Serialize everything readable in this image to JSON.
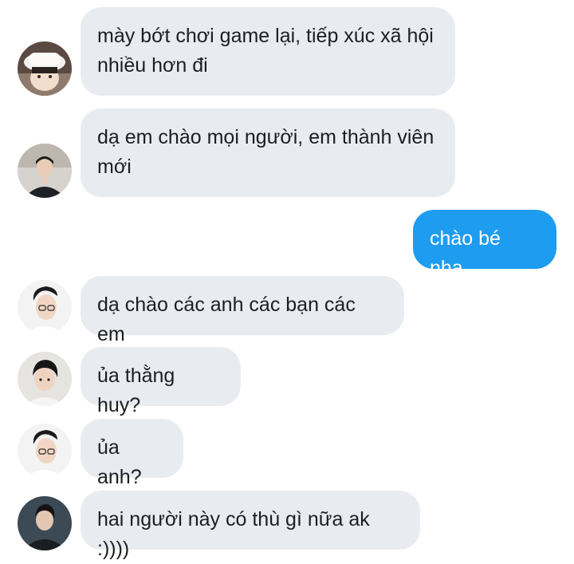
{
  "conversation": {
    "messages": [
      {
        "sender": "other",
        "avatar": "avatar-white-bucket-hat",
        "text": "mày bớt chơi game lại, tiếp xúc xã hội nhiều hơn đi"
      },
      {
        "sender": "other",
        "avatar": "avatar-dark-jacket",
        "text": "dạ em chào mọi người, em thành viên mới"
      },
      {
        "sender": "self",
        "text": "chào bé nha"
      },
      {
        "sender": "other",
        "avatar": "avatar-glasses",
        "text": "dạ chào các anh các bạn các em"
      },
      {
        "sender": "other",
        "avatar": "avatar-black-hair",
        "text": "ủa thằng huy?"
      },
      {
        "sender": "other",
        "avatar": "avatar-glasses",
        "text": "ủa anh?"
      },
      {
        "sender": "other",
        "avatar": "avatar-dark-jacket",
        "text": "hai người này có thù gì nữa ak :))))"
      }
    ]
  },
  "colors": {
    "incoming_bubble": "#e8ecf1",
    "outgoing_bubble": "#1e9cf0",
    "incoming_text": "#1c1e21",
    "outgoing_text": "#ffffff"
  }
}
